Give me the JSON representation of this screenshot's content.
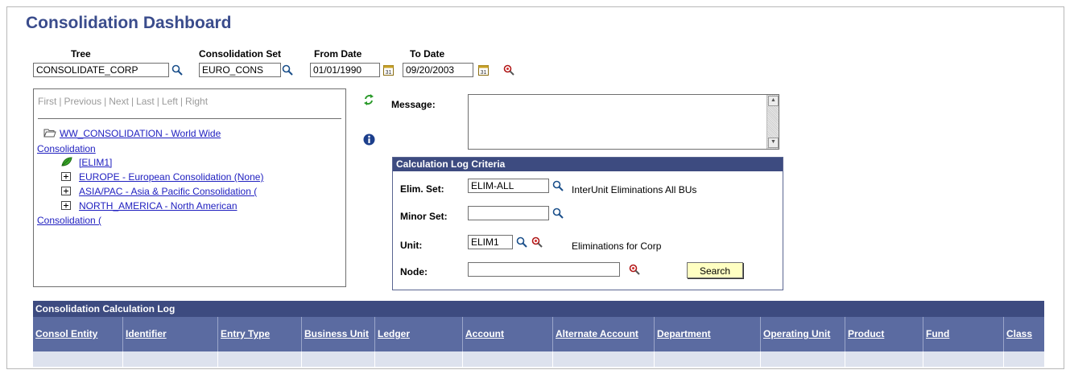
{
  "page_title": "Consolidation Dashboard",
  "filters": {
    "tree_label": "Tree",
    "tree_value": "CONSOLIDATE_CORP",
    "set_label": "Consolidation Set",
    "set_value": "EURO_CONS",
    "from_label": "From Date",
    "from_value": "01/01/1990",
    "to_label": "To Date",
    "to_value": "09/20/2003"
  },
  "tree_nav": {
    "first": "First",
    "previous": "Previous",
    "next": "Next",
    "last": "Last",
    "left": "Left",
    "right": "Right",
    "sep": "|"
  },
  "tree": {
    "root_line1": "WW_CONSOLIDATION - World Wide",
    "root_line2": "Consolidation",
    "elim": "[ELIM1]",
    "europe": "EUROPE - European Consolidation (None)",
    "asia": "ASIA/PAC - Asia & Pacific Consolidation (",
    "na_line1": "NORTH_AMERICA - North American",
    "na_line2": "Consolidation ("
  },
  "message_label": "Message:",
  "message_value": "",
  "criteria": {
    "header": "Calculation Log Criteria",
    "elim_label": "Elim. Set:",
    "elim_value": "ELIM-ALL",
    "elim_desc": "InterUnit Eliminations All BUs",
    "minor_label": "Minor Set:",
    "minor_value": "",
    "unit_label": "Unit:",
    "unit_value": "ELIM1",
    "unit_desc": "Eliminations for Corp",
    "node_label": "Node:",
    "node_value": "",
    "search_label": "Search"
  },
  "log": {
    "title": "Consolidation Calculation Log",
    "columns": [
      "Consol Entity",
      "Identifier",
      "Entry Type",
      "Business Unit",
      "Ledger",
      "Account",
      "Alternate Account",
      "Department",
      "Operating Unit",
      "Product",
      "Fund",
      "Class"
    ]
  },
  "colors": {
    "title": "#3a4c8c",
    "header_bar": "#3d4b80",
    "column_header": "#5b6ba1",
    "row": "#dde2ee",
    "link": "#2020c0",
    "button": "#ffffc2"
  }
}
